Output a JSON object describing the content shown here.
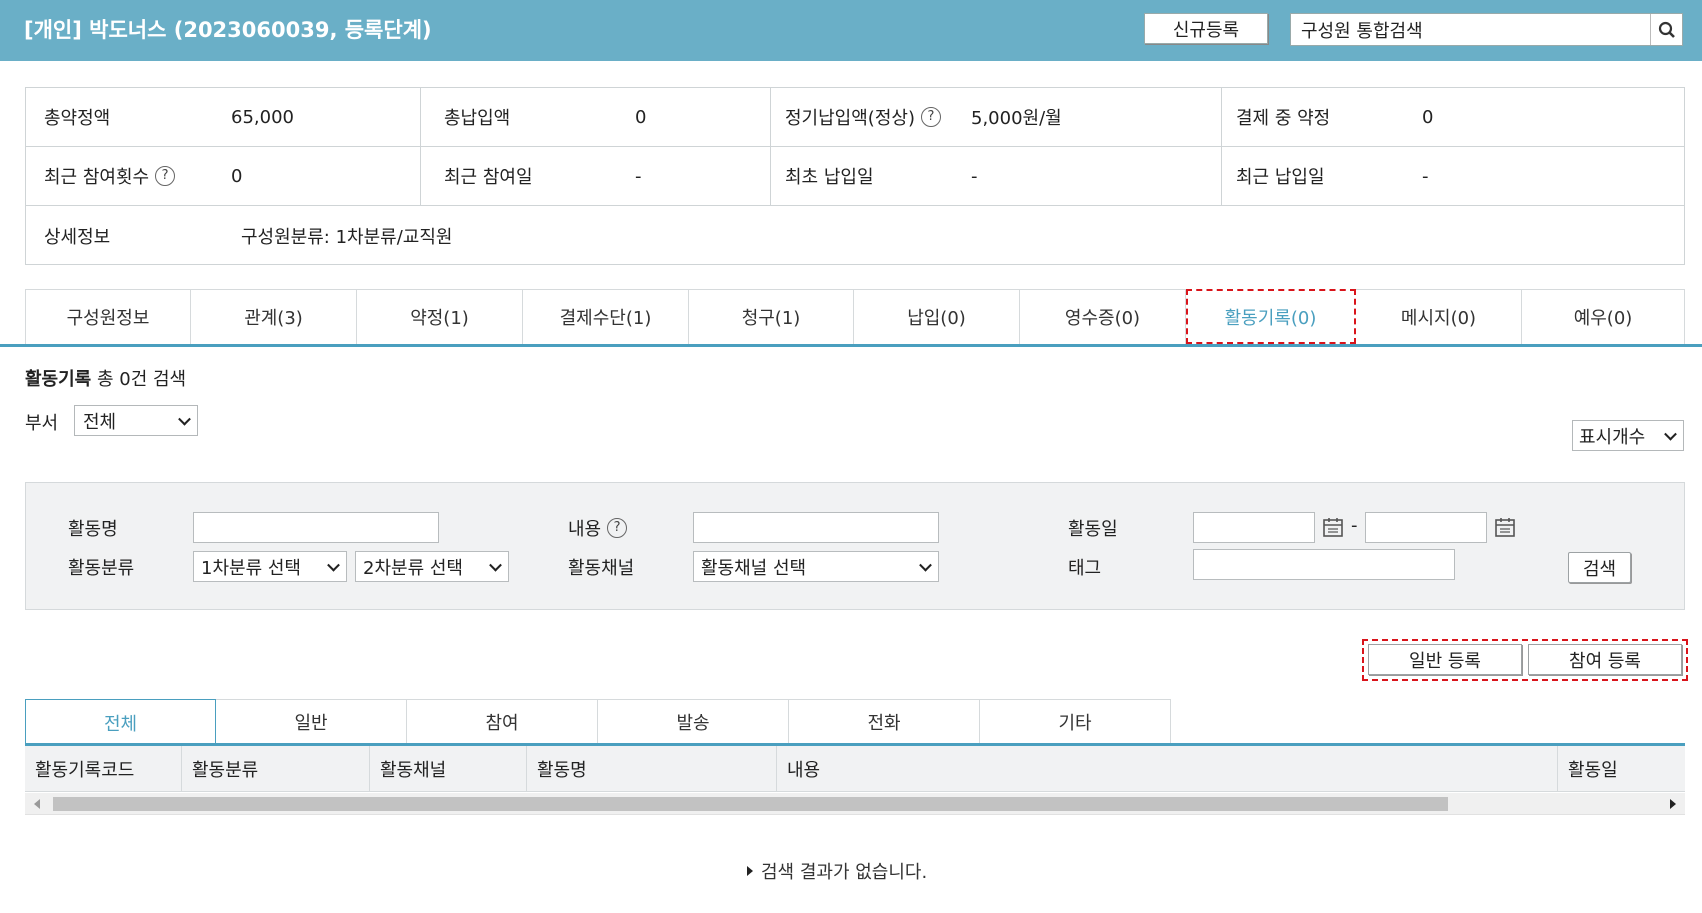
{
  "header": {
    "title": "[개인] 박도너스 (2023060039, 등록단계)",
    "new_button": "신규등록",
    "search_value": "구성원 통합검색",
    "color": "#6aafc7"
  },
  "summary": {
    "total_pledge_label": "총약정액",
    "total_pledge_value": "65,000",
    "total_paid_label": "총납입액",
    "total_paid_value": "0",
    "regular_paid_label": "정기납입액(정상)",
    "regular_paid_value": "5,000원/월",
    "pledge_in_payment_label": "결제 중 약정",
    "pledge_in_payment_value": "0",
    "recent_participation_label": "최근 참여횟수",
    "recent_participation_value": "0",
    "recent_participation_date_label": "최근 참여일",
    "recent_participation_date_value": "-",
    "first_paid_date_label": "최초 납입일",
    "first_paid_date_value": "-",
    "recent_paid_date_label": "최근 납입일",
    "recent_paid_date_value": "-",
    "detail_label": "상세정보",
    "detail_value": "구성원분류: 1차분류/교직원",
    "help_glyph": "?"
  },
  "tabs": [
    {
      "label": "구성원정보"
    },
    {
      "label": "관계(3)"
    },
    {
      "label": "약정(1)"
    },
    {
      "label": "결제수단(1)"
    },
    {
      "label": "청구(1)"
    },
    {
      "label": "납입(0)"
    },
    {
      "label": "영수증(0)"
    },
    {
      "label": "활동기록(0)"
    },
    {
      "label": "메시지(0)"
    },
    {
      "label": "예우(0)"
    }
  ],
  "activity": {
    "list_title": "활동기록",
    "list_count": "총 0건 검색",
    "dept_label": "부서",
    "dept_value": "전체",
    "display_count": "표시개수"
  },
  "filters": {
    "activity_name_label": "활동명",
    "content_label": "내용",
    "activity_date_label": "활동일",
    "date_separator": "-",
    "category_label": "활동분류",
    "category1_value": "1차분류 선택",
    "category2_value": "2차분류 선택",
    "channel_label": "활동채널",
    "channel_value": "활동채널 선택",
    "tag_label": "태그",
    "search_button": "검색"
  },
  "register": {
    "general": "일반 등록",
    "participation": "참여 등록"
  },
  "subtabs": [
    {
      "label": "전체"
    },
    {
      "label": "일반"
    },
    {
      "label": "참여"
    },
    {
      "label": "발송"
    },
    {
      "label": "전화"
    },
    {
      "label": "기타"
    }
  ],
  "grid": {
    "columns": [
      "활동기록코드",
      "활동분류",
      "활동채널",
      "활동명",
      "내용",
      "활동일"
    ],
    "empty_message": "검색 결과가 없습니다."
  }
}
